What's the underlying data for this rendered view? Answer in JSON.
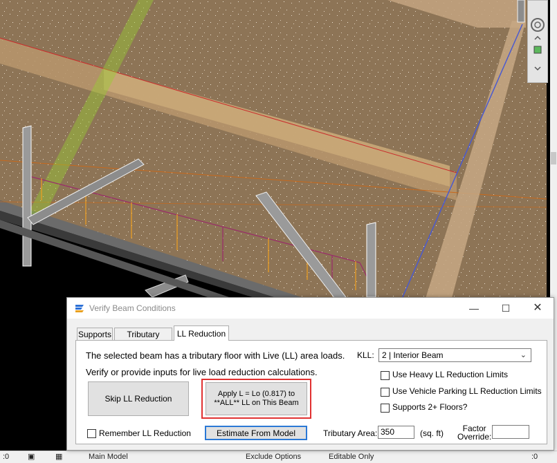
{
  "dialog": {
    "title": "Verify Beam Conditions",
    "tabs": [
      {
        "label": "Supports",
        "active": false
      },
      {
        "label": "Tributary Beams",
        "active": false
      },
      {
        "label": "LL Reduction",
        "active": true
      }
    ],
    "message_line1": "The selected beam has a tributary floor with Live (LL) area loads.",
    "message_line2": "Verify or provide inputs for live load reduction calculations.",
    "kll_label": "KLL:",
    "kll_selected": "2  |  Interior Beam",
    "skip_button": "Skip LL Reduction",
    "apply_button_line1": "Apply L = Lo (0.817) to",
    "apply_button_line2": "**ALL** LL on This Beam",
    "estimate_button": "Estimate From Model",
    "checkboxes": {
      "heavy": {
        "label": "Use Heavy LL Reduction Limits",
        "checked": false
      },
      "parking": {
        "label": "Use Vehicle Parking LL Reduction Limits",
        "checked": false
      },
      "floors": {
        "label": "Supports 2+ Floors?",
        "checked": false
      },
      "remember": {
        "label": "Remember LL Reduction",
        "checked": false
      }
    },
    "tributary_area_label": "Tributary Area:",
    "tributary_area_value": "350",
    "tributary_area_unit": "(sq. ft)",
    "factor_override_label_line1": "Factor",
    "factor_override_label_line2": "Override:",
    "factor_override_value": ""
  },
  "status_bar": {
    "coord": ":0",
    "model": "Main Model",
    "exclude": "Exclude Options",
    "editable": "Editable Only",
    "right_value": ":0"
  },
  "colors": {
    "floor": "#8d7456",
    "beam": "#b8976c",
    "highlight_border": "#e03030",
    "focus_border": "#2a78d6",
    "load_arrow": "#f0a020",
    "load_line": "#9a2a6a"
  }
}
